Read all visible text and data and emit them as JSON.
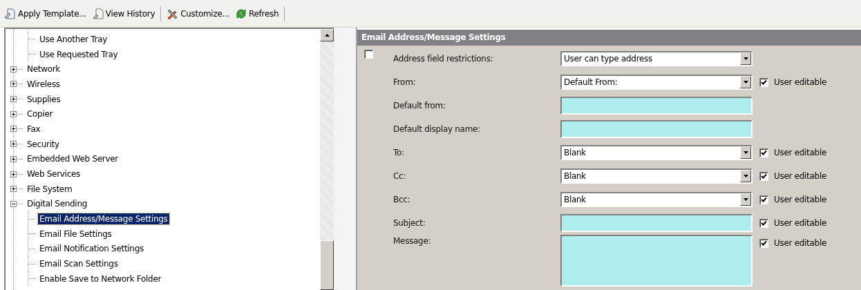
{
  "toolbar": [
    {
      "label": "Apply Template...",
      "kind": "template"
    },
    {
      "label": "View History",
      "kind": "history"
    },
    {
      "label": "Customize...",
      "kind": "customize"
    },
    {
      "label": "Refresh",
      "kind": "refresh"
    }
  ],
  "tree": {
    "continued_children": [
      {
        "label": "Use Another Tray",
        "selected": false
      },
      {
        "label": "Use Requested Tray",
        "selected": false
      }
    ],
    "items": [
      {
        "label": "Network",
        "expanded": false,
        "selected": false
      },
      {
        "label": "Wireless",
        "expanded": false,
        "selected": false
      },
      {
        "label": "Supplies",
        "expanded": false,
        "selected": false
      },
      {
        "label": "Copier",
        "expanded": false,
        "selected": false
      },
      {
        "label": "Fax",
        "expanded": false,
        "selected": false
      },
      {
        "label": "Security",
        "expanded": false,
        "selected": false
      },
      {
        "label": "Embedded Web Server",
        "expanded": false,
        "selected": false
      },
      {
        "label": "Web Services",
        "expanded": false,
        "selected": false
      },
      {
        "label": "File System",
        "expanded": false,
        "selected": false
      },
      {
        "label": "Digital Sending",
        "expanded": true,
        "selected": false,
        "children": [
          {
            "label": "Email Address/Message Settings",
            "selected": true
          },
          {
            "label": "Email File Settings",
            "selected": false
          },
          {
            "label": "Email Notification Settings",
            "selected": false
          },
          {
            "label": "Email Scan Settings",
            "selected": false
          },
          {
            "label": "Enable Save to Network Folder",
            "selected": false
          }
        ]
      }
    ]
  },
  "panel": {
    "title": "Email Address/Message Settings",
    "apply_checked": false,
    "rows": [
      {
        "kind": "select",
        "label": "Address field restrictions:",
        "value": "User can type address"
      },
      {
        "kind": "select",
        "label": "From:",
        "value": "Default From:",
        "user_editable": true,
        "editable_label": "User editable"
      },
      {
        "kind": "text",
        "label": "Default from:"
      },
      {
        "kind": "text",
        "label": "Default display name:"
      },
      {
        "kind": "select",
        "label": "To:",
        "value": "Blank",
        "user_editable": true,
        "editable_label": "User editable"
      },
      {
        "kind": "select",
        "label": "Cc:",
        "value": "Blank",
        "user_editable": true,
        "editable_label": "User editable"
      },
      {
        "kind": "select",
        "label": "Bcc:",
        "value": "Blank",
        "user_editable": true,
        "editable_label": "User editable"
      },
      {
        "kind": "text",
        "label": "Subject:",
        "user_editable": true,
        "editable_label": "User editable"
      },
      {
        "kind": "textarea",
        "label": "Message:",
        "user_editable": true,
        "editable_label": "User editable"
      }
    ]
  }
}
